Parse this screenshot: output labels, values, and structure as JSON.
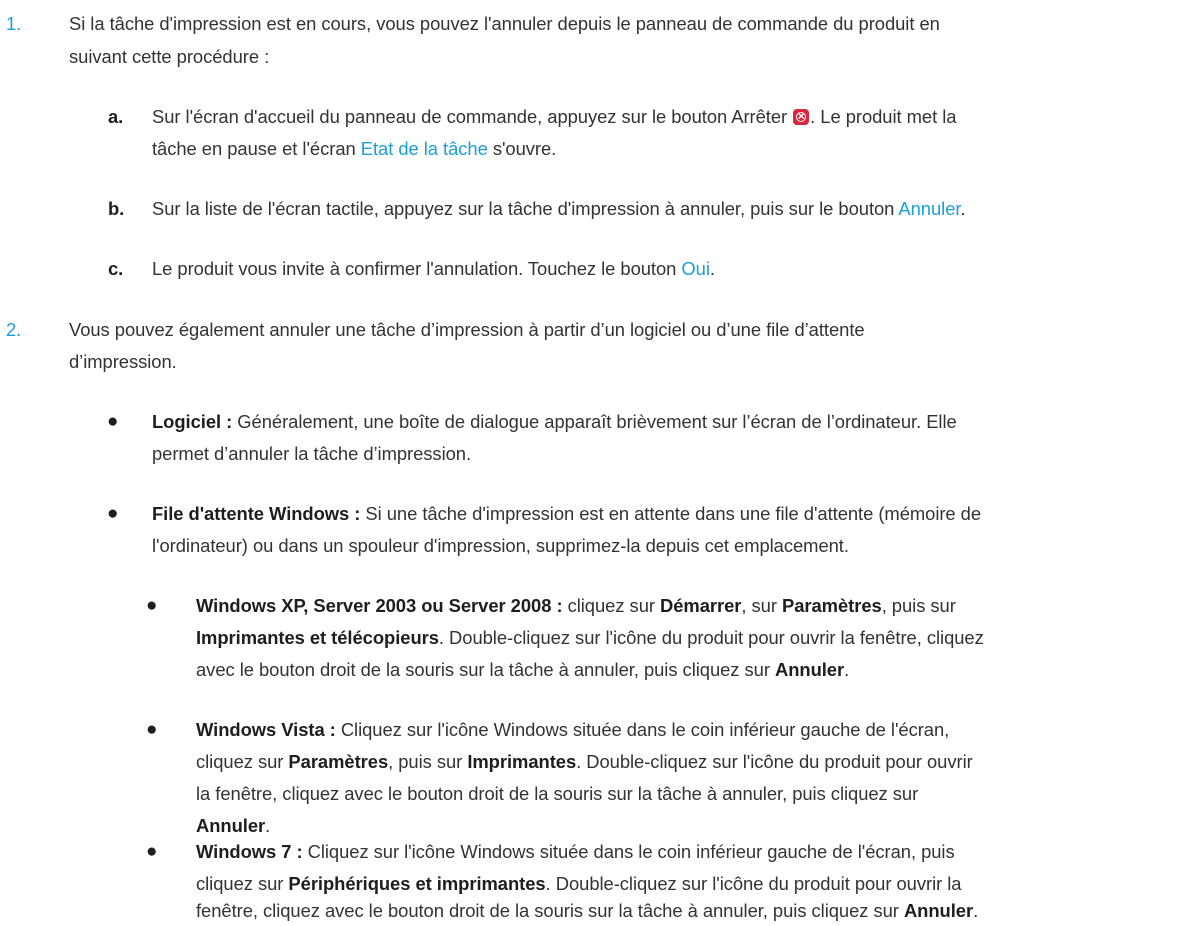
{
  "step1": {
    "number": "1.",
    "line1": "Si la tâche d'impression est en cours, vous pouvez l'annuler depuis le panneau de commande du produit en",
    "line2": "suivant cette procédure :",
    "substeps": [
      {
        "letter": "a.",
        "l1_pre": "Sur l'écran d'accueil du panneau de commande, appuyez sur le bouton Arrêter ",
        "l1_post": ". Le produit met la",
        "l2_pre": "tâche en pause et l'écran ",
        "l2_link": "Etat de la tâche",
        "l2_post": " s'ouvre."
      },
      {
        "letter": "b.",
        "l1_pre": "Sur la liste de l'écran tactile, appuyez sur la tâche d'impression à annuler, puis sur le bouton ",
        "l1_link": "Annuler",
        "l1_post": "."
      },
      {
        "letter": "c.",
        "l1_pre": "Le produit vous invite à confirmer l'annulation. Touchez le bouton ",
        "l1_link": "Oui",
        "l1_post": "."
      }
    ]
  },
  "step2": {
    "number": "2.",
    "line1": "Vous pouvez également annuler une tâche d’impression à partir d’un logiciel ou d’une file d’attente",
    "line2": "d’impression.",
    "bullet_logiciel": {
      "label": "Logiciel :",
      "l1": " Généralement, une boîte de dialogue apparaît brièvement sur l’écran de l’ordinateur. Elle",
      "l2": "permet d’annuler la tâche d’impression."
    },
    "bullet_windows": {
      "label": "File d'attente Windows :",
      "l1": " Si une tâche d'impression est en attente dans une file d'attente (mémoire de",
      "l2": "l'ordinateur) ou dans un spouleur d'impression, supprimez-la depuis cet emplacement."
    },
    "xp": {
      "label": "Windows XP, Server 2003 ou Server 2008 :",
      "t1": " cliquez sur ",
      "b1": "Démarrer",
      "t2": ", sur ",
      "b2": "Paramètres",
      "t3": ", puis sur",
      "b3": "Imprimantes et télécopieurs",
      "t4": ". Double-cliquez sur l'icône du produit pour ouvrir la fenêtre, cliquez",
      "t5": "avec le bouton droit de la souris sur la tâche à annuler, puis cliquez sur ",
      "b4": "Annuler",
      "t6": "."
    },
    "vista": {
      "label": "Windows Vista :",
      "t1": " Cliquez sur l'icône Windows située dans le coin inférieur gauche de l'écran,",
      "t2": "cliquez sur ",
      "b1": "Paramètres",
      "t3": ", puis sur ",
      "b2": "Imprimantes",
      "t4": ". Double-cliquez sur l'icône du produit pour ouvrir",
      "t5": "la fenêtre, cliquez avec le bouton droit de la souris sur la tâche à annuler, puis cliquez sur",
      "b3": "Annuler",
      "t6": "."
    },
    "win7": {
      "label": "Windows 7 :",
      "t1": " Cliquez sur l'icône Windows située dans le coin inférieur gauche de l'écran, puis",
      "t2": "cliquez sur ",
      "b1": "Périphériques et imprimantes",
      "t3": ". Double-cliquez sur l'icône du produit pour ouvrir la",
      "t4": "fenêtre, cliquez avec le bouton droit de la souris sur la tâche à annuler, puis cliquez sur ",
      "b2": "Annuler",
      "t5": "."
    },
    "bullet_glyph": "●"
  }
}
